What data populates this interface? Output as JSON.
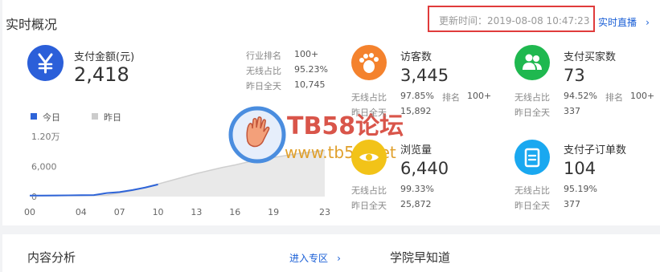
{
  "header": {
    "title": "实时概况",
    "update_text": "更新时间：2019-08-08 10:47:23",
    "live_link": "实时直播"
  },
  "payment": {
    "label": "支付金额(元)",
    "value": "2,418",
    "stats": [
      {
        "label": "行业排名",
        "value": "100+"
      },
      {
        "label": "无线占比",
        "value": "95.23%"
      },
      {
        "label": "昨日全天",
        "value": "10,745"
      }
    ]
  },
  "chart_data": {
    "type": "line",
    "legend": [
      "今日",
      "昨日"
    ],
    "y_ticks": [
      "1.20万",
      "6,000",
      "0"
    ],
    "x_ticks": [
      "00",
      "04",
      "07",
      "10",
      "13",
      "16",
      "19",
      "23"
    ],
    "ylim": [
      0,
      12000
    ],
    "series": [
      {
        "name": "今日",
        "color": "#2e64d8",
        "x": [
          0,
          1,
          2,
          3,
          4,
          5,
          6,
          7,
          8,
          9,
          10
        ],
        "y": [
          200,
          200,
          220,
          250,
          280,
          300,
          700,
          900,
          1300,
          1800,
          2418
        ]
      },
      {
        "name": "昨日",
        "color": "#cccccc",
        "x": [
          0,
          2,
          4,
          6,
          8,
          10,
          11,
          12,
          13,
          14,
          15,
          16,
          17,
          18,
          19,
          20,
          21,
          22,
          23
        ],
        "y": [
          200,
          220,
          260,
          300,
          1200,
          2500,
          3200,
          3900,
          4600,
          5200,
          5800,
          6300,
          6900,
          7400,
          7800,
          8200,
          8600,
          8900,
          9200
        ]
      }
    ]
  },
  "metrics": {
    "visitors": {
      "label": "访客数",
      "value": "3,445",
      "wireless_label": "无线占比",
      "wireless": "97.85%",
      "rank_label": "排名",
      "rank": "100+",
      "yesterday_label": "昨日全天",
      "yesterday": "15,892"
    },
    "buyers": {
      "label": "支付买家数",
      "value": "73",
      "wireless_label": "无线占比",
      "wireless": "94.52%",
      "rank_label": "排名",
      "rank": "100+",
      "yesterday_label": "昨日全天",
      "yesterday": "337"
    },
    "pageviews": {
      "label": "浏览量",
      "value": "6,440",
      "wireless_label": "无线占比",
      "wireless": "99.33%",
      "yesterday_label": "昨日全天",
      "yesterday": "25,872"
    },
    "orders": {
      "label": "支付子订单数",
      "value": "104",
      "wireless_label": "无线占比",
      "wireless": "95.19%",
      "yesterday_label": "昨日全天",
      "yesterday": "377"
    }
  },
  "watermark": {
    "title": "TB58论坛",
    "url": "www.tb58.net"
  },
  "bottom": {
    "content_title": "内容分析",
    "enter_link": "进入专区",
    "academy_title": "学院早知道"
  }
}
